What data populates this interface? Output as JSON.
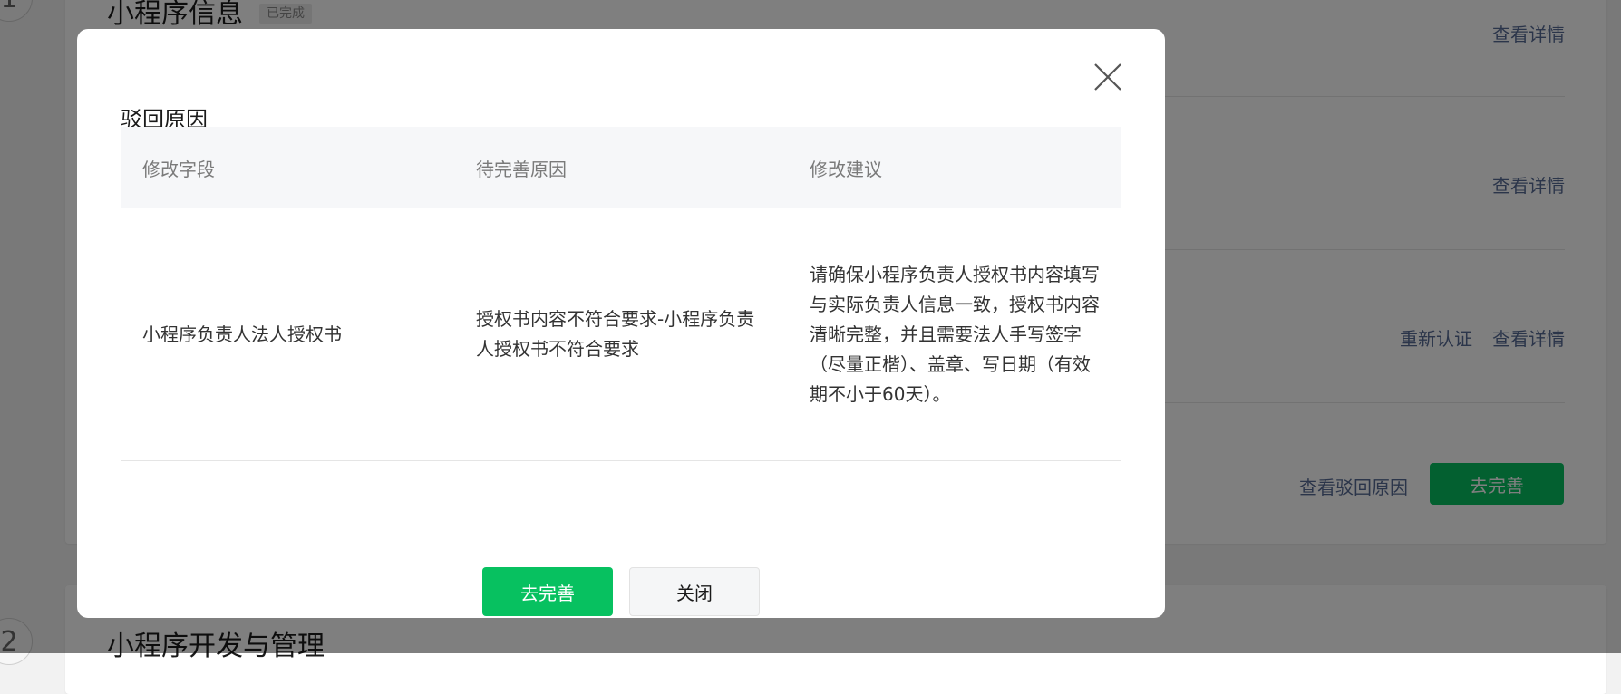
{
  "background": {
    "section1": {
      "step": "1",
      "title": "小程序信息",
      "badge": "已完成",
      "rows": [
        {
          "links": [
            "查看详情"
          ]
        },
        {
          "links": [
            "查看详情"
          ]
        },
        {
          "links": [
            "重新认证",
            "查看详情"
          ]
        },
        {
          "links": [
            "查看驳回原因"
          ],
          "button": "去完善"
        }
      ]
    },
    "section2": {
      "step": "2",
      "title": "小程序开发与管理"
    }
  },
  "dialog": {
    "title": "驳回原因",
    "close_icon": "close-icon",
    "table": {
      "headers": [
        "修改字段",
        "待完善原因",
        "修改建议"
      ],
      "rows": [
        {
          "field": "小程序负责人法人授权书",
          "reason": "授权书内容不符合要求-小程序负责人授权书不符合要求",
          "suggestion": "请确保小程序负责人授权书内容填写与实际负责人信息一致，授权书内容清晰完整，并且需要法人手写签字（尽量正楷）、盖章、写日期（有效期不小于60天）。"
        }
      ]
    },
    "buttons": {
      "primary": "去完善",
      "secondary": "关闭"
    }
  },
  "colors": {
    "primary": "#07c160",
    "link": "#576b95",
    "mask": "rgba(0,0,0,0.5)"
  }
}
